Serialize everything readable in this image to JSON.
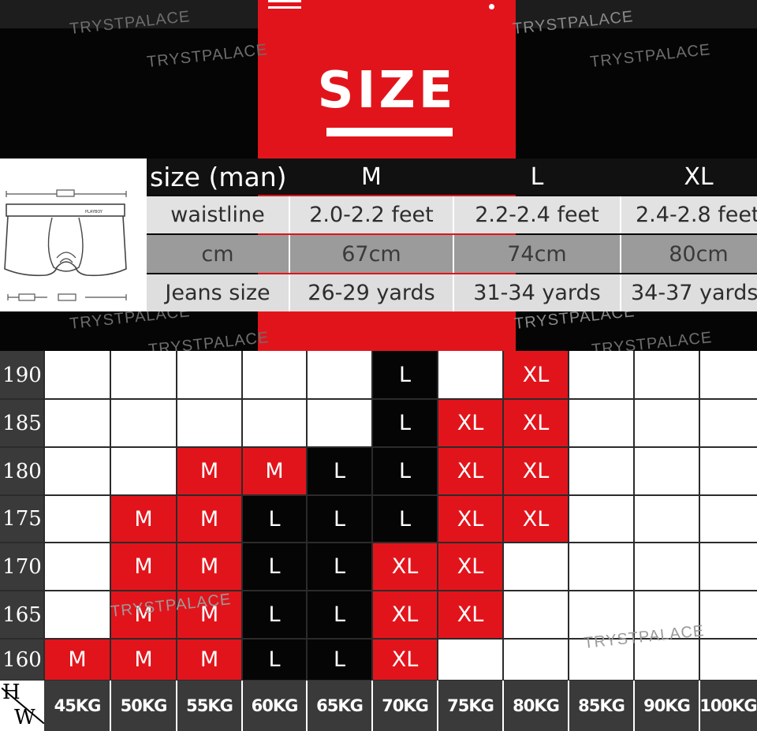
{
  "banner": {
    "title": "SIZE",
    "watermark": "TRYSTPALACE",
    "colors": {
      "red": "#e2141b",
      "black": "#050505",
      "white": "#ffffff"
    }
  },
  "size_table": {
    "header": [
      "size (man)",
      "M",
      "L",
      "XL"
    ],
    "rows": [
      [
        "waistline",
        "2.0-2.2 feet",
        "2.2-2.4 feet",
        "2.4-2.8 feet"
      ],
      [
        "cm",
        "67cm",
        "74cm",
        "80cm"
      ],
      [
        "Jeans size",
        "26-29 yards",
        "31-34 yards",
        "34-37 yards"
      ]
    ]
  },
  "product": {
    "brand_label": "PLAYBOY"
  },
  "grid": {
    "corner": {
      "h": "H",
      "w": "W"
    },
    "heights": [
      "190",
      "185",
      "180",
      "175",
      "170",
      "165",
      "160"
    ],
    "weights": [
      "45KG",
      "50KG",
      "55KG",
      "60KG",
      "65KG",
      "70KG",
      "75KG",
      "80KG",
      "85KG",
      "90KG",
      "100KG"
    ],
    "sizes": [
      [
        "",
        "",
        "",
        "",
        "",
        "L",
        "",
        "XL",
        "",
        "",
        ""
      ],
      [
        "",
        "",
        "",
        "",
        "",
        "L",
        "XL",
        "XL",
        "",
        "",
        ""
      ],
      [
        "",
        "",
        "M",
        "M",
        "L",
        "L",
        "XL",
        "XL",
        "",
        "",
        ""
      ],
      [
        "",
        "M",
        "M",
        "L",
        "L",
        "L",
        "XL",
        "XL",
        "",
        "",
        ""
      ],
      [
        "",
        "M",
        "M",
        "L",
        "L",
        "XL",
        "XL",
        "",
        "",
        "",
        ""
      ],
      [
        "",
        "M",
        "M",
        "L",
        "L",
        "XL",
        "XL",
        "",
        "",
        "",
        ""
      ],
      [
        "M",
        "M",
        "M",
        "L",
        "L",
        "XL",
        "",
        "",
        "",
        "",
        ""
      ]
    ]
  }
}
